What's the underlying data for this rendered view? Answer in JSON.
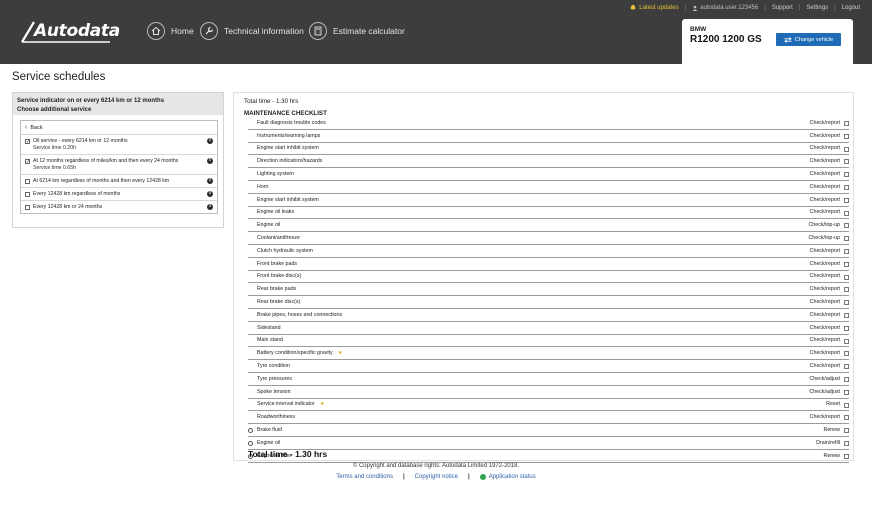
{
  "header": {
    "brand": "Autodata",
    "nav": [
      {
        "label": "Home",
        "icon": "home-icon"
      },
      {
        "label": "Technical information",
        "icon": "wrench-icon"
      },
      {
        "label": "Estimate calculator",
        "icon": "calculator-icon"
      }
    ],
    "topbar": {
      "latest_updates": "Latest updates",
      "user": "autodata.user.123456",
      "support": "Support",
      "settings": "Settings",
      "logout": "Logout"
    },
    "vehicle": {
      "make": "BMW",
      "model": "R1200 1200 GS",
      "change_label": "Change vehicle"
    },
    "colors": {
      "header_bg": "#3d3d3d",
      "accent": "#1f6bb5",
      "latest": "#e8c23a"
    }
  },
  "page": {
    "title": "Service schedules"
  },
  "left": {
    "head_line1": "Service indicator on or every 6214 km or 12 months",
    "head_line2": "Choose additional service",
    "back_label": "Back",
    "items": [
      {
        "label": "Oil service - every 6214 km or 12 months",
        "sub": "Service time 0.20h",
        "checked": true
      },
      {
        "label": "At 12 months regardless of miles/km and then every 24 months",
        "sub": "Service time 0.65h",
        "checked": true
      },
      {
        "label": "At 6214 km regardless of months and then every 12428 km",
        "sub": "",
        "checked": false
      },
      {
        "label": "Every 12428 km regardless of months",
        "sub": "",
        "checked": false
      },
      {
        "label": "Every 12428 km or 24 months",
        "sub": "",
        "checked": false
      }
    ]
  },
  "right": {
    "total_top": "Total time - 1.30 hrs",
    "checklist_title": "MAINTENANCE CHECKLIST",
    "rows": [
      {
        "name": "Fault diagnosis trouble codes",
        "action": "Check/report",
        "bullet": false,
        "star": false
      },
      {
        "name": "Instruments/warning lamps",
        "action": "Check/report",
        "bullet": false,
        "star": false
      },
      {
        "name": "Engine start inhibit system",
        "action": "Check/report",
        "bullet": false,
        "star": false
      },
      {
        "name": "Direction indicators/hazards",
        "action": "Check/report",
        "bullet": false,
        "star": false
      },
      {
        "name": "Lighting system",
        "action": "Check/report",
        "bullet": false,
        "star": false
      },
      {
        "name": "Horn",
        "action": "Check/report",
        "bullet": false,
        "star": false
      },
      {
        "name": "Engine start inhibit system",
        "action": "Check/report",
        "bullet": false,
        "star": false
      },
      {
        "name": "Engine oil leaks",
        "action": "Check/report",
        "bullet": false,
        "star": false
      },
      {
        "name": "Engine oil",
        "action": "Check/top-up",
        "bullet": false,
        "star": false
      },
      {
        "name": "Coolant/antifreeze",
        "action": "Check/top-up",
        "bullet": false,
        "star": false
      },
      {
        "name": "Clutch hydraulic system",
        "action": "Check/report",
        "bullet": false,
        "star": false
      },
      {
        "name": "Front brake pads",
        "action": "Check/report",
        "bullet": false,
        "star": false
      },
      {
        "name": "Front brake disc(s)",
        "action": "Check/report",
        "bullet": false,
        "star": false
      },
      {
        "name": "Rear brake pads",
        "action": "Check/report",
        "bullet": false,
        "star": false
      },
      {
        "name": "Rear brake disc(s)",
        "action": "Check/report",
        "bullet": false,
        "star": false
      },
      {
        "name": "Brake pipes, hoses and connections",
        "action": "Check/report",
        "bullet": false,
        "star": false
      },
      {
        "name": "Sidestand",
        "action": "Check/report",
        "bullet": false,
        "star": false
      },
      {
        "name": "Main stand",
        "action": "Check/report",
        "bullet": false,
        "star": false
      },
      {
        "name": "Battery condition/specific gravity",
        "action": "Check/report",
        "bullet": false,
        "star": true
      },
      {
        "name": "Tyre condition",
        "action": "Check/report",
        "bullet": false,
        "star": false
      },
      {
        "name": "Tyre pressures",
        "action": "Check/adjust",
        "bullet": false,
        "star": false
      },
      {
        "name": "Spoke tension",
        "action": "Check/adjust",
        "bullet": false,
        "star": false
      },
      {
        "name": "Service interval indicator",
        "action": "Reset",
        "bullet": false,
        "star": true
      },
      {
        "name": "Roadworthiness",
        "action": "Check/report",
        "bullet": false,
        "star": false
      },
      {
        "name": "Brake fluid",
        "action": "Renew",
        "bullet": true,
        "star": false
      },
      {
        "name": "Engine oil",
        "action": "Drain/refill",
        "bullet": true,
        "star": false
      },
      {
        "name": "Engine oil filter",
        "action": "Renew",
        "bullet": true,
        "star": false
      }
    ],
    "total_bottom": "Total time - 1.30 hrs"
  },
  "footer": {
    "copyright": "© Copyright and database rights: Autodata Limited 1972-2018.",
    "terms": "Terms and conditions",
    "copyright_notice": "Copyright notice",
    "app_status": "Application status"
  }
}
